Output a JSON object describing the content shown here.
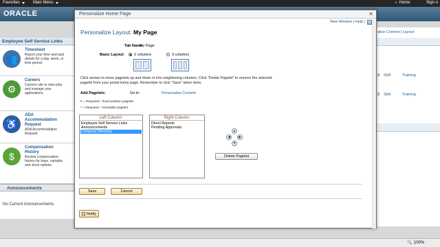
{
  "topbar": {
    "favorites": "Favorites",
    "main_menu": "Main Menu",
    "home": "Home",
    "sign_out": "Sign o"
  },
  "brand": {
    "logo": "ORACLE"
  },
  "left_panel": {
    "title": "Employee Self Service Links",
    "tiles": [
      {
        "title": "Timesheet",
        "desc": "Report your time and task details for a day, week, or time period.",
        "icon": "timesheet-icon"
      },
      {
        "title": "Careers",
        "desc": "Careers site to view jobs and manage your applications.",
        "icon": "careers-icon"
      },
      {
        "title": "ADA Accommodation Request",
        "desc": "ADA Accommodation Request",
        "icon": "accessibility-icon"
      },
      {
        "title": "Compensation History",
        "desc": "Review compensation history for base, variable, and stock options.",
        "icon": "dollar-icon"
      }
    ]
  },
  "announcements": {
    "title": "Announcements",
    "body": "No Current Announcements."
  },
  "right_bg": {
    "links": "alize Content | Layout",
    "row_num": "3",
    "skill": "Skill",
    "training": "Training"
  },
  "modal": {
    "title": "Personalize Home Page",
    "links": "New Window | Help |",
    "heading_prefix": "Personalize Layout:",
    "heading_page": "My Page",
    "tab_name_label": "Tab Name",
    "tab_name_value": "My Page",
    "basic_layout_label": "Basic Layout:",
    "option_two": "2 columns",
    "option_three": "3 columns",
    "instructions": "Click arrows to move pagelets up and down or into neighboring columns. Click \"Delete Pagelet\" to remove the selected pagelet from your portal home page. Remember to click \"Save\" when done.",
    "add_pagelets_label": "Add Pagelets:",
    "goto_label": "Go to",
    "personalize_content": "Personalize Content",
    "legend_fixed": "# = Required - fixed position pagelet",
    "legend_move": "* = Required - moveable pagelet",
    "left_column": {
      "header": "Left Column:",
      "items": [
        "Employee Self Service Links",
        "Announcements",
        "Company Directory"
      ],
      "selected": 2
    },
    "right_column": {
      "header": "Right Column:",
      "items": [
        "Direct Reports",
        "Pending Approvals"
      ]
    },
    "delete_label": "Delete Pagelet",
    "save_label": "Save",
    "cancel_label": "Cancel",
    "notify_label": "Notify"
  },
  "statusbar": {
    "zoom": "100%"
  }
}
